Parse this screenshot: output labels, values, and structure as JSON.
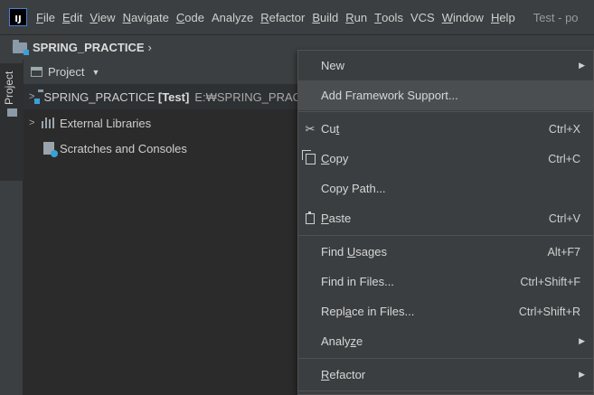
{
  "menubar": {
    "items": [
      {
        "label": "File",
        "mnemonic": "F",
        "rest": "ile"
      },
      {
        "label": "Edit",
        "mnemonic": "E",
        "rest": "dit"
      },
      {
        "label": "View",
        "mnemonic": "V",
        "rest": "iew"
      },
      {
        "label": "Navigate",
        "mnemonic": "N",
        "rest": "avigate"
      },
      {
        "label": "Code",
        "mnemonic": "C",
        "rest": "ode"
      },
      {
        "label": "Analyze",
        "mnemonic": "",
        "rest": "Analyze"
      },
      {
        "label": "Refactor",
        "mnemonic": "R",
        "rest": "efactor"
      },
      {
        "label": "Build",
        "mnemonic": "B",
        "rest": "uild"
      },
      {
        "label": "Run",
        "mnemonic": "R",
        "rest": "un"
      },
      {
        "label": "Tools",
        "mnemonic": "T",
        "rest": "ools"
      },
      {
        "label": "VCS",
        "mnemonic": "",
        "rest": "VCS"
      },
      {
        "label": "Window",
        "mnemonic": "W",
        "rest": "indow"
      },
      {
        "label": "Help",
        "mnemonic": "H",
        "rest": "elp"
      }
    ],
    "window_title": "Test - po"
  },
  "breadcrumb": {
    "project": "SPRING_PRACTICE",
    "chevron": "›"
  },
  "stripe": {
    "tab_label": "Project"
  },
  "panel": {
    "title": "Project",
    "tree": [
      {
        "name": "SPRING_PRACTICE",
        "tag": "[Test]",
        "path": "E:₩SPRING_PRACTICE"
      },
      {
        "name": "External Libraries"
      },
      {
        "name": "Scratches and Consoles"
      }
    ]
  },
  "context_menu": {
    "new": {
      "pre": "",
      "u": "",
      "post": "New"
    },
    "add_framework": {
      "pre": "",
      "u": "",
      "post": "Add Framework Support..."
    },
    "cut": {
      "pre": "Cu",
      "u": "t",
      "post": "",
      "shortcut": "Ctrl+X"
    },
    "copy": {
      "pre": "",
      "u": "C",
      "post": "opy",
      "shortcut": "Ctrl+C"
    },
    "copy_path": {
      "pre": "",
      "u": "",
      "post": "Copy Path..."
    },
    "paste": {
      "pre": "",
      "u": "P",
      "post": "aste",
      "shortcut": "Ctrl+V"
    },
    "find_usages": {
      "pre": "Find ",
      "u": "U",
      "post": "sages",
      "shortcut": "Alt+F7"
    },
    "find_in_files": {
      "pre": "",
      "u": "",
      "post": "Find in Files...",
      "shortcut": "Ctrl+Shift+F"
    },
    "replace_in_files": {
      "pre": "Repl",
      "u": "a",
      "post": "ce in Files...",
      "shortcut": "Ctrl+Shift+R"
    },
    "analyze": {
      "pre": "Analy",
      "u": "z",
      "post": "e"
    },
    "refactor": {
      "pre": "",
      "u": "R",
      "post": "efactor"
    }
  }
}
